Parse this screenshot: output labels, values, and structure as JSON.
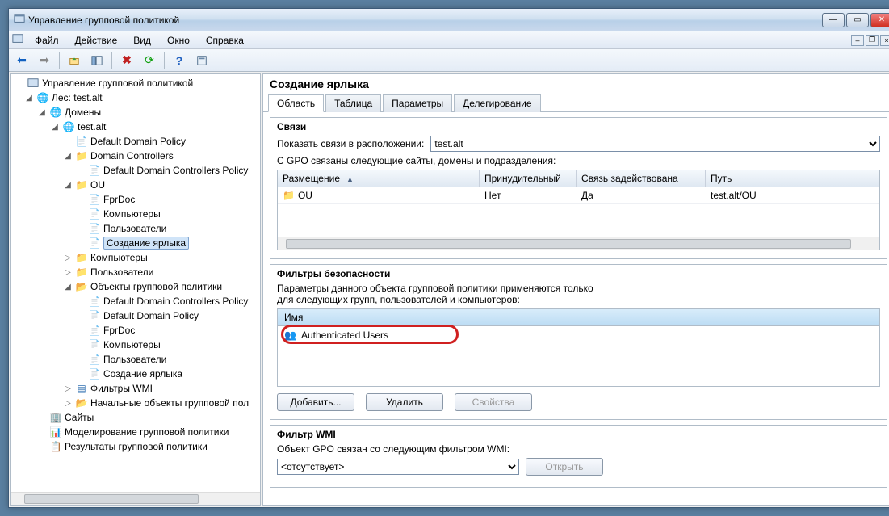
{
  "window": {
    "title": "Управление групповой политикой"
  },
  "menu": {
    "file": "Файл",
    "action": "Действие",
    "view": "Вид",
    "window": "Окно",
    "help": "Справка"
  },
  "tree": {
    "root": "Управление групповой политикой",
    "forest": "Лес: test.alt",
    "domains": "Домены",
    "domain": "test.alt",
    "default_domain_policy": "Default Domain Policy",
    "domain_controllers": "Domain Controllers",
    "default_dc_policy": "Default Domain Controllers Policy",
    "ou": "OU",
    "fprdoc": "FprDoc",
    "computers_link": "Компьютеры",
    "users_link": "Пользователи",
    "create_shortcut": "Создание ярлыка",
    "computers": "Компьютеры",
    "users": "Пользователи",
    "gpos": "Объекты групповой политики",
    "gpo_ddcp": "Default Domain Controllers Policy",
    "gpo_ddp": "Default Domain Policy",
    "gpo_fprdoc": "FprDoc",
    "gpo_comp": "Компьютеры",
    "gpo_users": "Пользователи",
    "gpo_shortcut": "Создание ярлыка",
    "wmi_filters": "Фильтры WMI",
    "starter_gpos": "Начальные объекты групповой пол",
    "sites": "Сайты",
    "modeling": "Моделирование групповой политики",
    "results": "Результаты групповой политики"
  },
  "header": {
    "title": "Создание ярлыка"
  },
  "tabs": {
    "scope": "Область",
    "details": "Таблица",
    "settings": "Параметры",
    "delegation": "Делегирование"
  },
  "links": {
    "title": "Связи",
    "show_in_label": "Показать связи в расположении:",
    "location_value": "test.alt",
    "caption": "С GPO связаны следующие сайты, домены и подразделения:",
    "col_location": "Размещение",
    "col_enforced": "Принудительный",
    "col_link_enabled": "Связь задействована",
    "col_path": "Путь",
    "row_location": "OU",
    "row_enforced": "Нет",
    "row_link_enabled": "Да",
    "row_path": "test.alt/OU"
  },
  "security": {
    "title": "Фильтры безопасности",
    "caption1": "Параметры данного объекта групповой политики применяются только",
    "caption2": "для следующих групп, пользователей и компьютеров:",
    "col_name": "Имя",
    "row_name": "Authenticated Users",
    "btn_add": "Добавить...",
    "btn_remove": "Удалить",
    "btn_props": "Свойства"
  },
  "wmi": {
    "title": "Фильтр WMI",
    "caption": "Объект GPO связан со следующим фильтром WMI:",
    "value": "<отсутствует>",
    "btn_open": "Открыть"
  }
}
